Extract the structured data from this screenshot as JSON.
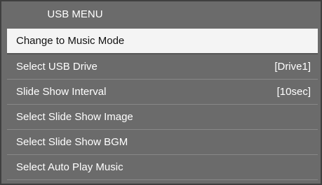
{
  "menu": {
    "title": "USB MENU",
    "items": [
      {
        "label": "Change to Music Mode",
        "value": ""
      },
      {
        "label": "Select USB Drive",
        "value": "[Drive1]"
      },
      {
        "label": "Slide Show Interval",
        "value": "[10sec]"
      },
      {
        "label": "Select Slide Show Image",
        "value": ""
      },
      {
        "label": "Select Slide Show BGM",
        "value": ""
      },
      {
        "label": "Select Auto Play Music",
        "value": ""
      }
    ],
    "selected_index": 0
  },
  "colors": {
    "panel_background": "#6b6b6b",
    "panel_border": "#3f3f3f",
    "selected_background": "#f4f4f4",
    "text": "#ffffff",
    "selected_text": "#111111"
  }
}
